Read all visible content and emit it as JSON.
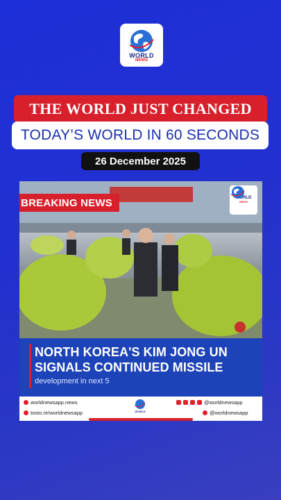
{
  "brand": {
    "logo_word": "WORLD",
    "logo_sub": "NEWS"
  },
  "header": {
    "headline": "THE WORLD JUST CHANGED",
    "subheadline": "TODAY’S WORLD IN 60 SECONDS",
    "date": "26 December 2025"
  },
  "card": {
    "badge": "BREAKING NEWS",
    "caption_line1": "NORTH KOREA'S KIM JONG UN",
    "caption_line2": "SIGNALS CONTINUED MISSILE",
    "caption_sub": "development in next 5"
  },
  "footer": {
    "website": "worldnewsapp.news",
    "link": "tosto.re/worldnewsapp",
    "handle_1": "@worldnewsapp",
    "handle_2": "@worldnewsapp"
  },
  "colors": {
    "accent_red": "#d8202c",
    "brand_blue": "#1a2fb0",
    "bg_blue": "#2330cf"
  },
  "icons": [
    "globe-icon",
    "instagram-icon",
    "twitter-icon",
    "link-icon"
  ]
}
